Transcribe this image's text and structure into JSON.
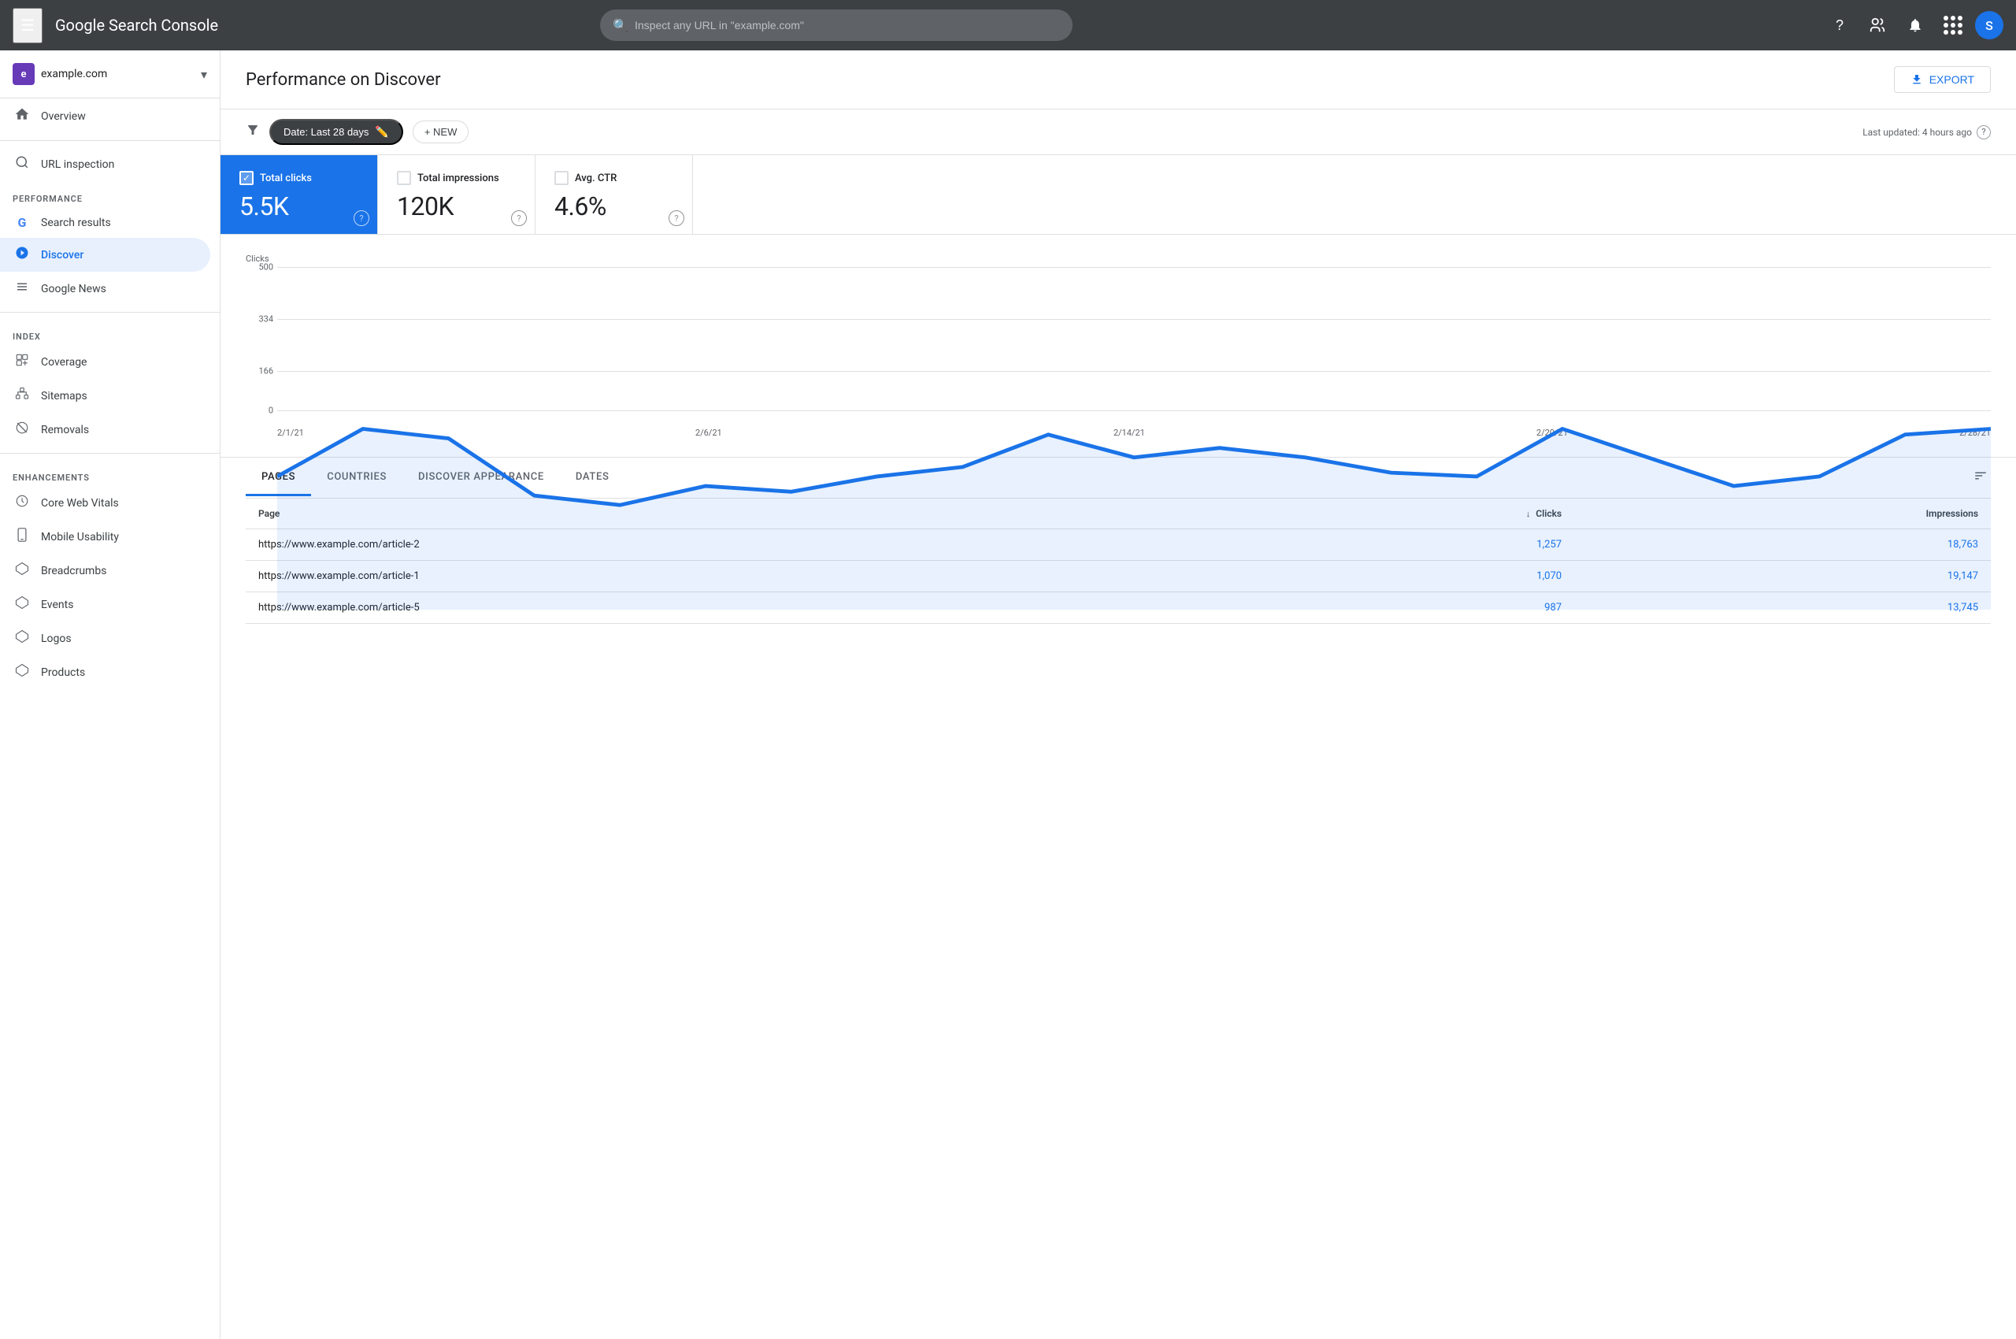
{
  "topbar": {
    "menu_label": "☰",
    "logo_text": "Google Search Console",
    "search_placeholder": "Inspect any URL in \"example.com\"",
    "help_icon": "?",
    "users_icon": "👥",
    "bell_icon": "🔔",
    "avatar_letter": "S"
  },
  "sidebar": {
    "property": {
      "icon_letter": "e",
      "name": "example.com",
      "chevron": "▾"
    },
    "nav": {
      "overview_label": "Overview",
      "performance_section": "Performance",
      "url_inspection_label": "URL inspection",
      "search_results_label": "Search results",
      "discover_label": "Discover",
      "google_news_label": "Google News",
      "index_section": "Index",
      "coverage_label": "Coverage",
      "sitemaps_label": "Sitemaps",
      "removals_label": "Removals",
      "enhancements_section": "Enhancements",
      "core_web_vitals_label": "Core Web Vitals",
      "mobile_usability_label": "Mobile Usability",
      "breadcrumbs_label": "Breadcrumbs",
      "events_label": "Events",
      "logos_label": "Logos",
      "products_label": "Products"
    }
  },
  "main": {
    "title": "Performance on Discover",
    "export_label": "EXPORT",
    "filter": {
      "date_label": "Date: Last 28 days",
      "new_label": "+ NEW",
      "last_updated": "Last updated: 4 hours ago"
    },
    "metrics": [
      {
        "label": "Total clicks",
        "value": "5.5K",
        "active": true
      },
      {
        "label": "Total impressions",
        "value": "120K",
        "active": false
      },
      {
        "label": "Avg. CTR",
        "value": "4.6%",
        "active": false
      }
    ],
    "chart": {
      "y_label": "Clicks",
      "y_ticks": [
        "500",
        "334",
        "166",
        "0"
      ],
      "x_labels": [
        "2/1/21",
        "2/6/21",
        "2/14/21",
        "2/20/21",
        "2/28/21"
      ]
    },
    "tabs": [
      {
        "label": "PAGES",
        "active": true
      },
      {
        "label": "COUNTRIES",
        "active": false
      },
      {
        "label": "DISCOVER APPEARANCE",
        "active": false
      },
      {
        "label": "DATES",
        "active": false
      }
    ],
    "table": {
      "columns": [
        {
          "label": "Page",
          "numeric": false,
          "sort": false
        },
        {
          "label": "Clicks",
          "numeric": true,
          "sort": true
        },
        {
          "label": "Impressions",
          "numeric": true,
          "sort": false
        }
      ],
      "rows": [
        {
          "page": "https://www.example.com/article-2",
          "clicks": "1,257",
          "impressions": "18,763"
        },
        {
          "page": "https://www.example.com/article-1",
          "clicks": "1,070",
          "impressions": "19,147"
        },
        {
          "page": "https://www.example.com/article-5",
          "clicks": "987",
          "impressions": "13,745"
        }
      ]
    }
  }
}
